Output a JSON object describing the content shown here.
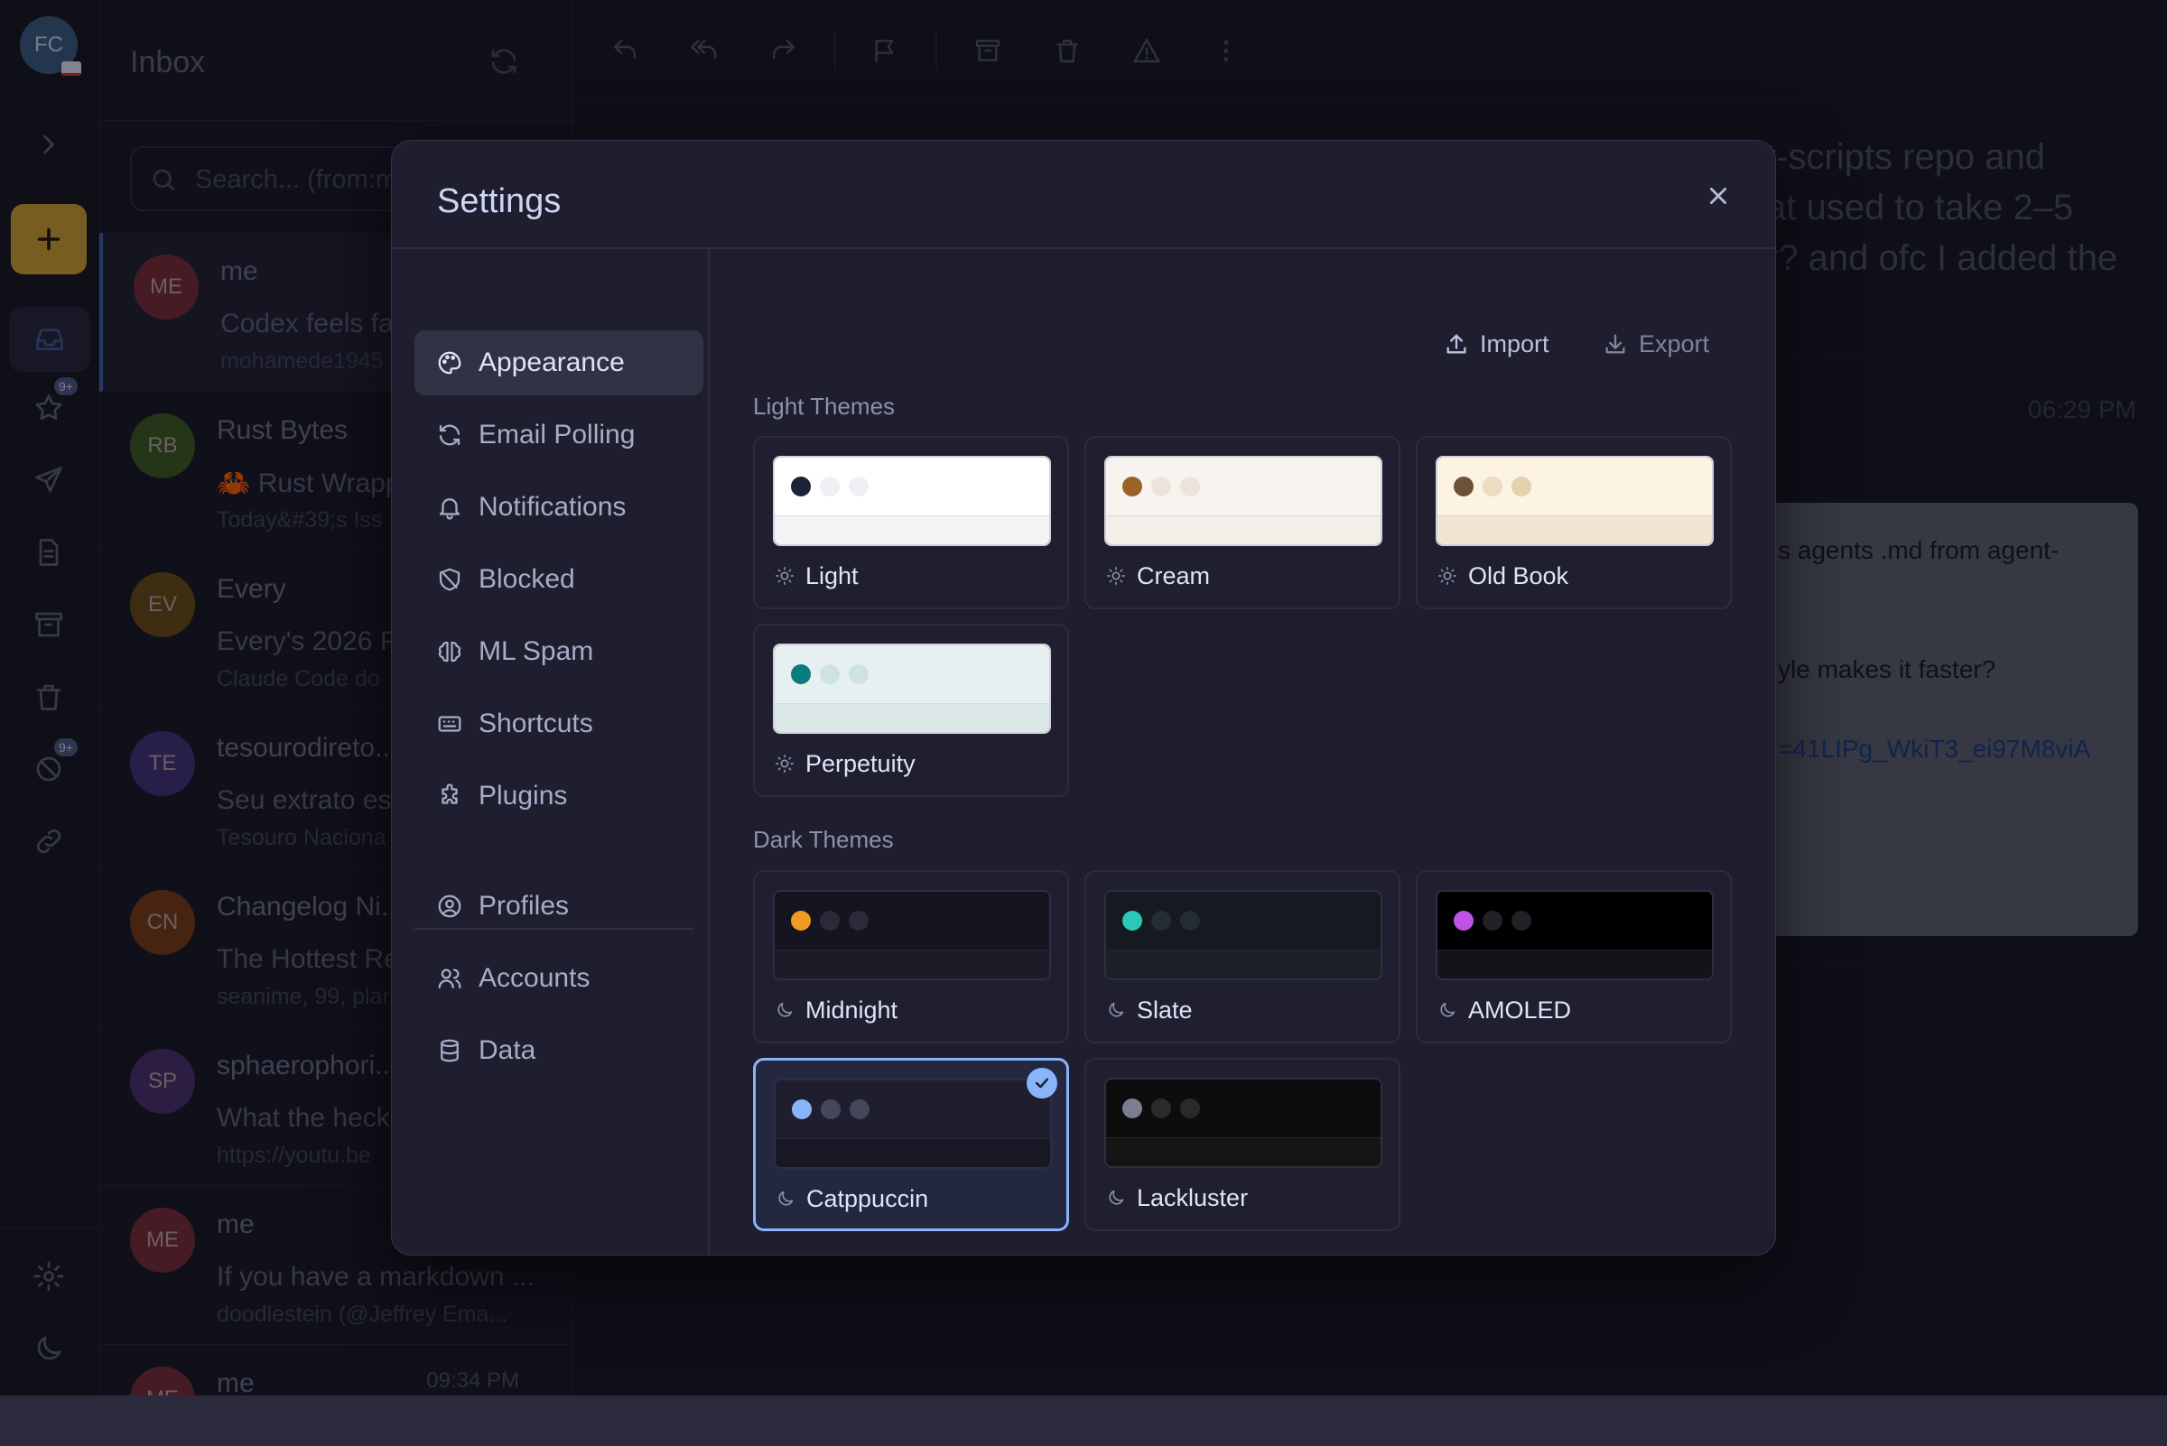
{
  "account": {
    "initials": "FC"
  },
  "rail": {
    "starred_badge": "9+",
    "spam_badge": "9+"
  },
  "list": {
    "title": "Inbox",
    "search_placeholder": "Search... (from:m",
    "items": [
      {
        "initials": "ME",
        "sender": "me",
        "subject": "Codex feels fa",
        "snippet": "mohamede1945",
        "time": "",
        "color": "#7a2a35"
      },
      {
        "initials": "RB",
        "sender": "Rust Bytes",
        "subject": "🦀 Rust Wrapp",
        "snippet": "Today&#39;s Iss",
        "time": "",
        "color": "#3d5a1e"
      },
      {
        "initials": "EV",
        "sender": "Every",
        "subject": "Every's 2026 P",
        "snippet": "Claude Code do",
        "time": "",
        "color": "#6b4c12"
      },
      {
        "initials": "TE",
        "sender": "tesourodireto...",
        "subject": "Seu extrato est",
        "snippet": "Tesouro Naciona",
        "time": "",
        "color": "#43307a"
      },
      {
        "initials": "CN",
        "sender": "Changelog Ni...",
        "subject": "The Hottest Re",
        "snippet": "seanime, 99, plar",
        "time": "",
        "color": "#7a3a14"
      },
      {
        "initials": "SP",
        "sender": "sphaerophori...",
        "subject": "What the heck",
        "snippet": "https://youtu.be",
        "time": "",
        "color": "#4a2f6e"
      },
      {
        "initials": "ME",
        "sender": "me",
        "subject": "If you have a markdown ...",
        "snippet": "doodlestein (@Jeffrey Ema...",
        "time": "",
        "color": "#7a2a35"
      },
      {
        "initials": "ME",
        "sender": "me",
        "subject": "",
        "snippet": "",
        "time": "09:34 PM",
        "color": "#7a2a35"
      }
    ]
  },
  "reading": {
    "headline_lines": [
      "t-scripts repo and",
      "at used to take 2–5",
      "r? and ofc I added the"
    ],
    "time": "06:29 PM",
    "body_line1": "s agents .md from agent-",
    "body_line2": "yle makes it faster?",
    "body_link": "=41LIPg_WkiT3_ei97M8viA"
  },
  "settings": {
    "title": "Settings",
    "nav": [
      {
        "label": "Appearance",
        "icon": "palette-icon",
        "active": true
      },
      {
        "label": "Email Polling",
        "icon": "refresh-icon"
      },
      {
        "label": "Notifications",
        "icon": "bell-icon"
      },
      {
        "label": "Blocked",
        "icon": "shield-off-icon"
      },
      {
        "label": "ML Spam",
        "icon": "brain-icon"
      },
      {
        "label": "Shortcuts",
        "icon": "keyboard-icon"
      },
      {
        "label": "Plugins",
        "icon": "puzzle-icon"
      },
      {
        "label": "Profiles",
        "icon": "user-circle-icon"
      },
      {
        "label": "Accounts",
        "icon": "users-icon"
      },
      {
        "label": "Data",
        "icon": "database-icon"
      }
    ],
    "import_label": "Import",
    "export_label": "Export",
    "light_section": "Light Themes",
    "dark_section": "Dark Themes",
    "light_themes": [
      {
        "name": "Light",
        "top": "#ffffff",
        "bottom": "#f4f4f6",
        "dots": [
          "#1e2235",
          "#eef0f4",
          "#eef0f4"
        ]
      },
      {
        "name": "Cream",
        "top": "#f7f4ef",
        "bottom": "#f3efe8",
        "dots": [
          "#9a6227",
          "#ece4da",
          "#ece4da"
        ]
      },
      {
        "name": "Old Book",
        "top": "#fcf3e3",
        "bottom": "#f0e6d2",
        "dots": [
          "#6e5236",
          "#eddcc0",
          "#e2d2ae"
        ]
      },
      {
        "name": "Perpetuity",
        "top": "#e6f0f0",
        "bottom": "#dce8e8",
        "dots": [
          "#0a7c80",
          "#cfe2e3",
          "#cfe2e3"
        ]
      }
    ],
    "dark_themes": [
      {
        "name": "Midnight",
        "top": "#151520",
        "bottom": "#1c1c29",
        "dots": [
          "#f29b24",
          "#2a2a38",
          "#2a2a38"
        ],
        "selected": false
      },
      {
        "name": "Slate",
        "top": "#141a1f",
        "bottom": "#1a2026",
        "dots": [
          "#2bc8b8",
          "#262c33",
          "#262c33"
        ],
        "selected": false
      },
      {
        "name": "AMOLED",
        "top": "#000000",
        "bottom": "#141418",
        "dots": [
          "#c152e8",
          "#222226",
          "#222226"
        ],
        "selected": false
      },
      {
        "name": "Catppuccin",
        "top": "#1e1e2e",
        "bottom": "#181825",
        "dots": [
          "#89b4fa",
          "#45475a",
          "#45475a"
        ],
        "selected": true
      },
      {
        "name": "Lackluster",
        "top": "#0d0d0d",
        "bottom": "#151515",
        "dots": [
          "#7a7e92",
          "#2a2a2a",
          "#2a2a2a"
        ],
        "selected": false
      }
    ]
  }
}
